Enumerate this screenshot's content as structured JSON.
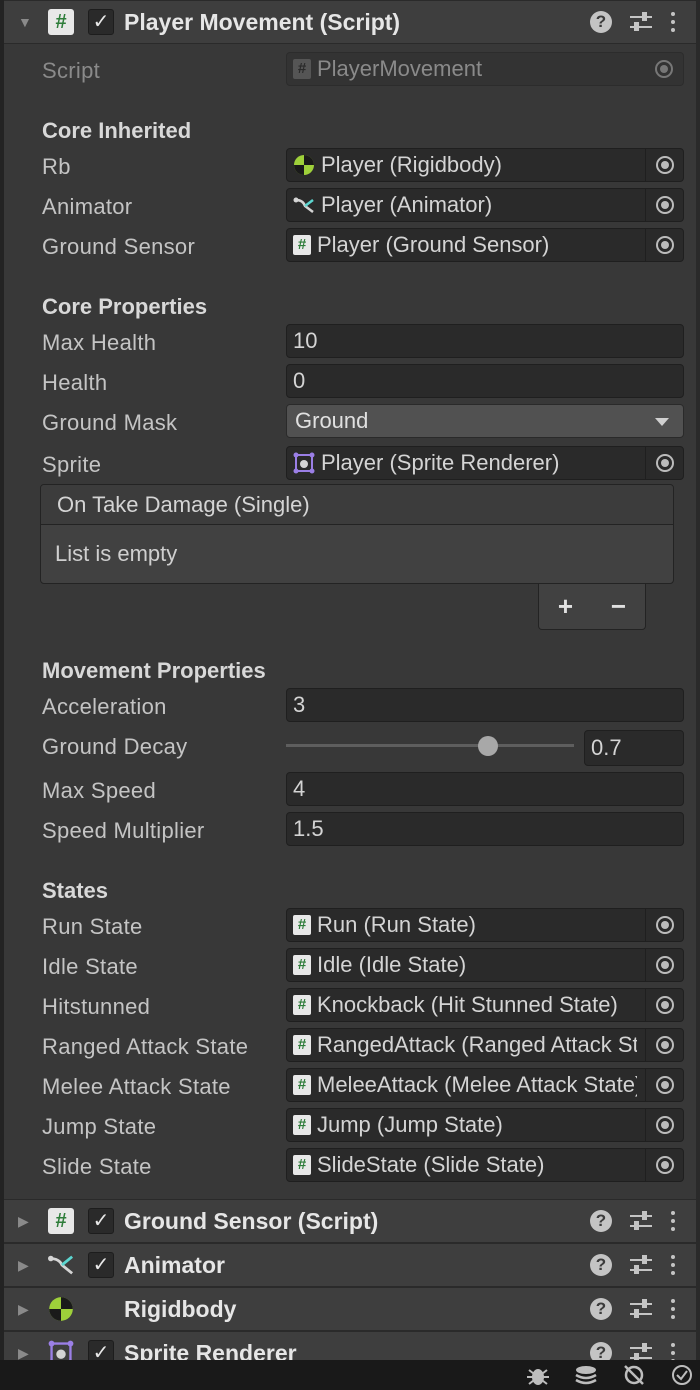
{
  "components": {
    "player_movement": {
      "title": "Player Movement (Script)"
    },
    "ground_sensor": {
      "title": "Ground Sensor (Script)"
    },
    "animator": {
      "title": "Animator"
    },
    "rigidbody": {
      "title": "Rigidbody"
    },
    "sprite_renderer": {
      "title": "Sprite Renderer"
    }
  },
  "script_field": {
    "label": "Script",
    "value": "PlayerMovement"
  },
  "sections": {
    "core_inherited": "Core Inherited",
    "core_properties": "Core Properties",
    "movement_properties": "Movement Properties",
    "states": "States"
  },
  "core_inherited": {
    "rb": {
      "label": "Rb",
      "value": "Player (Rigidbody)"
    },
    "animator": {
      "label": "Animator",
      "value": "Player (Animator)"
    },
    "ground_sensor": {
      "label": "Ground Sensor",
      "value": "Player (Ground Sensor)"
    }
  },
  "core_properties": {
    "max_health": {
      "label": "Max Health",
      "value": "10"
    },
    "health": {
      "label": "Health",
      "value": "0"
    },
    "ground_mask": {
      "label": "Ground Mask",
      "value": "Ground"
    },
    "sprite": {
      "label": "Sprite",
      "value": "Player (Sprite Renderer)"
    }
  },
  "event": {
    "title": "On Take Damage (Single)",
    "empty_text": "List is empty",
    "plus": "+",
    "minus": "−"
  },
  "movement": {
    "acceleration": {
      "label": "Acceleration",
      "value": "3"
    },
    "ground_decay": {
      "label": "Ground Decay",
      "value": "0.7",
      "slider_fraction": 0.7
    },
    "max_speed": {
      "label": "Max Speed",
      "value": "4"
    },
    "speed_multiplier": {
      "label": "Speed Multiplier",
      "value": "1.5"
    }
  },
  "states": {
    "run": {
      "label": "Run State",
      "value": "Run (Run State)"
    },
    "idle": {
      "label": "Idle State",
      "value": "Idle (Idle State)"
    },
    "hitstunned": {
      "label": "Hitstunned",
      "value": "Knockback (Hit Stunned State)"
    },
    "ranged": {
      "label": "Ranged Attack State",
      "value": "RangedAttack (Ranged Attack State)"
    },
    "melee": {
      "label": "Melee Attack State",
      "value": "MeleeAttack (Melee Attack State)"
    },
    "jump": {
      "label": "Jump State",
      "value": "Jump (Jump State)"
    },
    "slide": {
      "label": "Slide State",
      "value": "SlideState (Slide State)"
    }
  },
  "icons": {
    "help": "?",
    "check": "✓",
    "fold_open": "▼",
    "fold_closed": "▶",
    "hash": "#"
  }
}
